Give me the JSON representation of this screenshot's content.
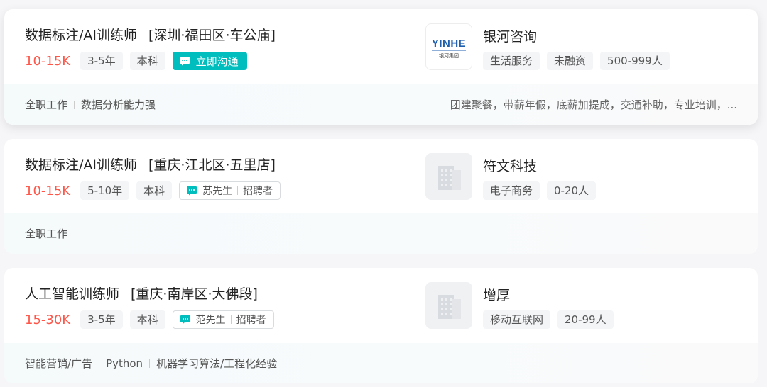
{
  "jobs": [
    {
      "title": "数据标注/AI训练师",
      "location": "[深圳·福田区·车公庙]",
      "salary": "10-15K",
      "experience": "3-5年",
      "degree": "本科",
      "chat_label": "立即沟通",
      "company": "银河咨询",
      "company_tags": [
        "生活服务",
        "未融资",
        "500-999人"
      ],
      "logo_text": "YINHE",
      "logo_sub": "银河集团",
      "skills": [
        "全职工作",
        "数据分析能力强"
      ],
      "welfare": "团建聚餐，带薪年假，底薪加提成，交通补助，专业培训，..."
    },
    {
      "title": "数据标注/AI训练师",
      "location": "[重庆·江北区·五里店]",
      "salary": "10-15K",
      "experience": "5-10年",
      "degree": "本科",
      "recruiter_name": "苏先生",
      "recruiter_role": "招聘者",
      "company": "符文科技",
      "company_tags": [
        "电子商务",
        "0-20人"
      ],
      "skills": [
        "全职工作"
      ]
    },
    {
      "title": "人工智能训练师",
      "location": "[重庆·南岸区·大佛段]",
      "salary": "15-30K",
      "experience": "3-5年",
      "degree": "本科",
      "recruiter_name": "范先生",
      "recruiter_role": "招聘者",
      "company": "增厚",
      "company_tags": [
        "移动互联网",
        "20-99人"
      ],
      "skills": [
        "智能营销/广告",
        "Python",
        "机器学习算法/工程化经验"
      ]
    }
  ],
  "colors": {
    "salary": "#fe574a",
    "accent": "#00bebd",
    "logo_blue": "#1f5fb0"
  },
  "icons": {
    "chat": "chat-bubble-icon",
    "company_placeholder": "building-icon"
  }
}
